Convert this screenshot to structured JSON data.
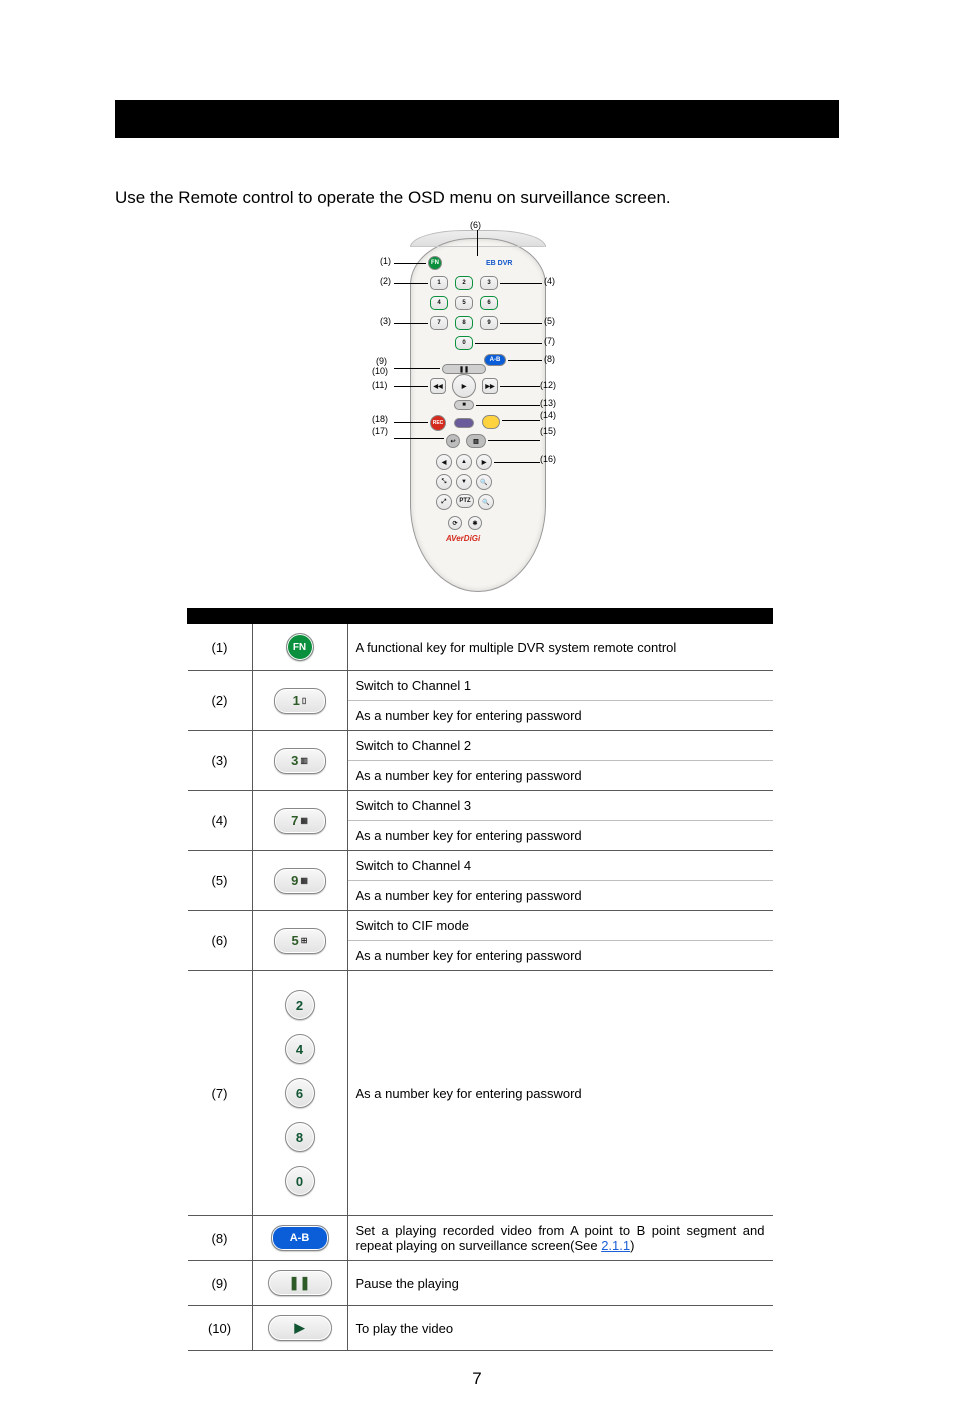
{
  "intro": "Use the Remote control to operate the OSD menu on surveillance screen.",
  "remote": {
    "eb_dvr_label": "EB DVR",
    "brand": "AVerDiGi",
    "callouts_left": {
      "c1": "(1)",
      "c2": "(2)",
      "c3": "(3)",
      "c9": "(9)",
      "c10": "(10)",
      "c11": "(11)",
      "c18": "(18)",
      "c17": "(17)"
    },
    "callouts_right": {
      "c4": "(4)",
      "c5": "(5)",
      "c7": "(7)",
      "c8": "(8)",
      "c12": "(12)",
      "c13": "(13)",
      "c14": "(14)",
      "c15": "(15)",
      "c16": "(16)"
    },
    "callouts_top": {
      "c6": "(6)"
    },
    "btn_fn": "FN",
    "btn_ab": "A-B",
    "btn_rec": "REC",
    "btn_ptz": "PTZ",
    "num1": "1",
    "num2": "2",
    "num3": "3",
    "num4": "4",
    "num5": "5",
    "num6": "6",
    "num7": "7",
    "num8": "8",
    "num9": "9",
    "num0": "0"
  },
  "table": {
    "rows": [
      {
        "n": "(1)",
        "key_type": "fn",
        "key_label": "FN",
        "lines": [
          "A functional key for multiple DVR system remote control"
        ]
      },
      {
        "n": "(2)",
        "key_type": "num",
        "key_label": "1",
        "key_glyph": "▯",
        "lines": [
          "Switch to Channel 1",
          "As a number key for entering password"
        ]
      },
      {
        "n": "(3)",
        "key_type": "num",
        "key_label": "3",
        "key_glyph": "▥",
        "lines": [
          "Switch to Channel 2",
          "As a number key for entering password"
        ]
      },
      {
        "n": "(4)",
        "key_type": "num",
        "key_label": "7",
        "key_glyph": "▦",
        "lines": [
          "Switch to Channel 3",
          "As a number key for entering password"
        ]
      },
      {
        "n": "(5)",
        "key_type": "num",
        "key_label": "9",
        "key_glyph": "▦",
        "lines": [
          "Switch to Channel 4",
          "As a number key for entering password"
        ]
      },
      {
        "n": "(6)",
        "key_type": "num",
        "key_label": "5",
        "key_glyph": "⊞",
        "lines": [
          "Switch to CIF mode",
          "As a number key for entering password"
        ]
      },
      {
        "n": "(7)",
        "key_type": "stack",
        "key_labels": [
          "2",
          "4",
          "6",
          "8",
          "0"
        ],
        "lines": [
          "As a number key for entering password"
        ]
      },
      {
        "n": "(8)",
        "key_type": "ab",
        "key_label": "A-B",
        "lines_html": "Set a playing recorded video from A point to B point segment and repeat playing on surveillance screen(See <a href='#'>2.1.1</a>)",
        "link_text": "2.1.1"
      },
      {
        "n": "(9)",
        "key_type": "wide",
        "key_label": "❚❚",
        "lines": [
          "Pause the playing"
        ]
      },
      {
        "n": "(10)",
        "key_type": "wide",
        "key_label": "▶",
        "lines": [
          "To play the video"
        ]
      }
    ]
  },
  "page_number": "7"
}
